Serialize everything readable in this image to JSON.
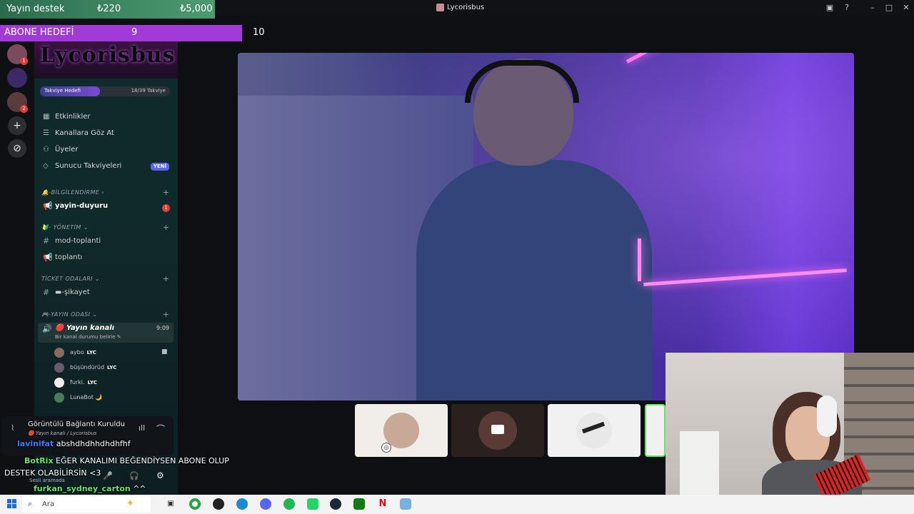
{
  "window": {
    "title": "Lycorisbus"
  },
  "overlay": {
    "support_label": "Yayın destek",
    "support_current": "₺220",
    "support_target": "₺5,000",
    "sub_goal_label": "ABONE HEDEFİ",
    "sub_goal_current": "9",
    "sub_goal_target": "10",
    "sub_goal_progress": 0.9
  },
  "server_rail": {
    "items": [
      {
        "name": "server-1",
        "badge": "1",
        "color": "#7b4a5c"
      },
      {
        "name": "server-2",
        "badge": "",
        "color": "#3b2a66"
      },
      {
        "name": "server-3",
        "badge": "2",
        "color": "#5a3b3b"
      }
    ],
    "add_icon": "plus-icon",
    "explore_icon": "compass-icon"
  },
  "server": {
    "banner_text": "Lycorisbus",
    "boost_label": "Takviye Hedefi",
    "boost_count": "18/39 Takviye",
    "boost_progress": 0.46
  },
  "menu": [
    {
      "icon": "calendar-icon",
      "glyph": "▦",
      "label": "Etkinlikler"
    },
    {
      "icon": "browse-icon",
      "glyph": "☰",
      "label": "Kanallara Göz At"
    },
    {
      "icon": "members-icon",
      "glyph": "👥",
      "label": "Üyeler"
    },
    {
      "icon": "boost-icon",
      "glyph": "◇",
      "label": "Sunucu Takviyeleri",
      "badge": "YENİ"
    }
  ],
  "categories": {
    "info": "🔔-BİLGİLENDİRME ›",
    "admin": "🔰- YÖNETİM ⌄",
    "ticket": "TİCKET ODALARI ⌄",
    "stream": "🎮-YAYIN ODASI ⌄"
  },
  "channels": {
    "announce": {
      "name": "yayin-duyuru",
      "badge": "1"
    },
    "mod": "mod-toplanti",
    "meeting": "toplantı",
    "complaint": "▬-şikayet",
    "voice": {
      "name": "🔴 Yayın kanalı",
      "status": "Bir kanal durumu belirle ✎",
      "time": "9:09"
    }
  },
  "voice_users": [
    {
      "name": "aybo",
      "tag": "LYC",
      "color": "#8a6a5a",
      "camera": true
    },
    {
      "name": "büşündürüd",
      "tag": "LYC",
      "color": "#6a5a6a",
      "camera": false
    },
    {
      "name": "furki.",
      "tag": "LYC",
      "color": "#eeeeee",
      "camera": false
    },
    {
      "name": "LunaBot 🌙",
      "tag": "",
      "color": "#4a7a5a",
      "camera": false
    }
  ],
  "voice_panel": {
    "status": "Görüntülü Bağlantı Kuruldu",
    "channel": "🔴 Yayın kanalı / Lycorisbus",
    "user_status": "Sesli aramada"
  },
  "chat": [
    {
      "name": "lavinifat",
      "text": "abshdhdhhdhdhfhf",
      "name_color": "#3a7bff"
    },
    {
      "name": "BotRix",
      "text": "EĞER KANALIMI BEĞENDİYSEN ABONE OLUP",
      "name_color": "#6be36b"
    },
    {
      "name": "",
      "text": "DESTEK OLABİLİRSİN <3",
      "name_color": "#ffffff"
    },
    {
      "name": "furkan_sydney_carton",
      "text": "^^",
      "name_color": "#6be36b"
    }
  ],
  "taskbar": {
    "search_placeholder": "Ara",
    "apps": [
      "task-view-icon",
      "chrome-icon",
      "obs-icon",
      "edge-icon",
      "discord-icon",
      "spotify-icon",
      "whatsapp-icon",
      "steam-icon",
      "xbox-icon",
      "netflix-icon",
      "app-icon"
    ]
  }
}
